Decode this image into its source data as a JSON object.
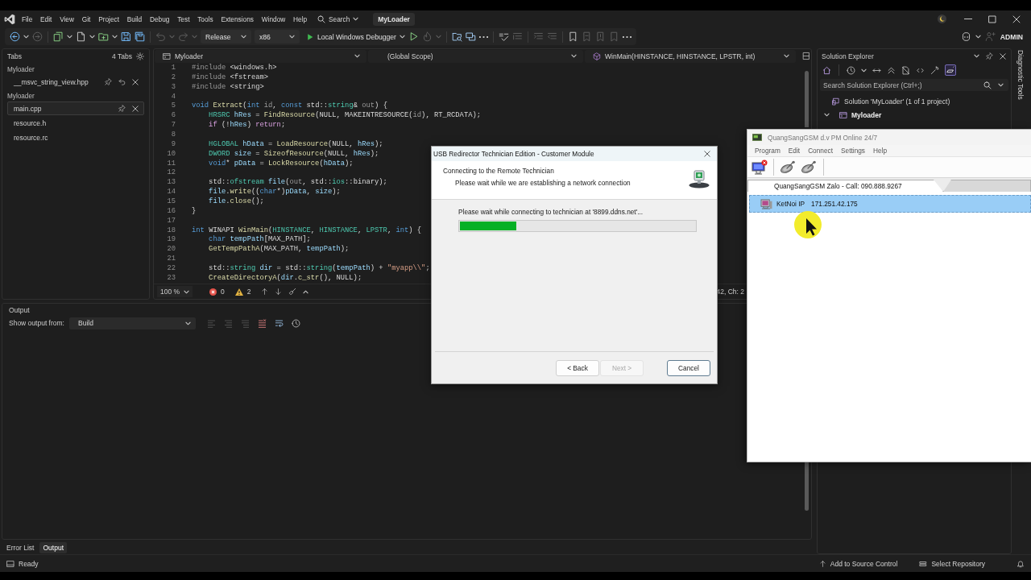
{
  "ide": {
    "menu": [
      "File",
      "Edit",
      "View",
      "Git",
      "Project",
      "Build",
      "Debug",
      "Test",
      "Tools",
      "Extensions",
      "Window",
      "Help"
    ],
    "search": "Search",
    "solution_title": "MyLoader",
    "configuration": "Release",
    "platform": "x86",
    "debugger": "Local Windows Debugger",
    "account": "ADMIN"
  },
  "tabs_panel": {
    "title": "Tabs",
    "count": "4 Tabs",
    "groups": [
      {
        "name": "Myloader",
        "files": [
          {
            "name": "__msvc_string_view.hpp",
            "kind": "preview",
            "selected": false
          }
        ]
      },
      {
        "name": "Myloader",
        "files": [
          {
            "name": "main.cpp",
            "kind": "document",
            "selected": true
          },
          {
            "name": "resource.h",
            "kind": "document",
            "selected": false
          },
          {
            "name": "resource.rc",
            "kind": "document",
            "selected": false
          }
        ]
      }
    ]
  },
  "editor": {
    "project": "Myloader",
    "scope": "(Global Scope)",
    "member": "WinMain(HINSTANCE, HINSTANCE, LPSTR, int)",
    "lines": [
      {
        "number": "1",
        "tokens": [
          {
            "kind": "pre",
            "text": "#include "
          },
          {
            "kind": "hdr",
            "text": "<windows.h>"
          }
        ]
      },
      {
        "number": "2",
        "tokens": [
          {
            "kind": "pre",
            "text": "#include "
          },
          {
            "kind": "hdr",
            "text": "<fstream>"
          }
        ]
      },
      {
        "number": "3",
        "tokens": [
          {
            "kind": "pre",
            "text": "#include "
          },
          {
            "kind": "hdr",
            "text": "<string>"
          }
        ]
      },
      {
        "number": "4"
      },
      {
        "number": "5",
        "tokens": [
          {
            "kind": "kw",
            "text": "void "
          },
          {
            "kind": "fn",
            "text": "Extract"
          },
          {
            "kind": "txt",
            "text": "("
          },
          {
            "kind": "kw",
            "text": "int "
          },
          {
            "kind": "param",
            "text": "id"
          },
          {
            "kind": "txt",
            "text": ", "
          },
          {
            "kind": "kw",
            "text": "const "
          },
          {
            "kind": "txt",
            "text": "std::"
          },
          {
            "kind": "type",
            "text": "string"
          },
          {
            "kind": "txt",
            "text": "& "
          },
          {
            "kind": "param",
            "text": "out"
          },
          {
            "kind": "txt",
            "text": ") {"
          }
        ]
      },
      {
        "number": "6",
        "tokens": [
          {
            "kind": "type",
            "text": "    HRSRC "
          },
          {
            "kind": "var",
            "text": "hRes"
          },
          {
            "kind": "txt",
            "text": " = "
          },
          {
            "kind": "fn",
            "text": "FindResource"
          },
          {
            "kind": "txt",
            "text": "(NULL, MAKEINTRESOURCE("
          },
          {
            "kind": "param",
            "text": "id"
          },
          {
            "kind": "txt",
            "text": "), RT_RCDATA);"
          }
        ]
      },
      {
        "number": "7",
        "tokens": [
          {
            "kind": "ctl",
            "text": "    if "
          },
          {
            "kind": "txt",
            "text": "(!"
          },
          {
            "kind": "var",
            "text": "hRes"
          },
          {
            "kind": "txt",
            "text": ") "
          },
          {
            "kind": "ctl",
            "text": "return"
          },
          {
            "kind": "txt",
            "text": ";"
          }
        ]
      },
      {
        "number": "8"
      },
      {
        "number": "9",
        "tokens": [
          {
            "kind": "type",
            "text": "    HGLOBAL "
          },
          {
            "kind": "var",
            "text": "hData"
          },
          {
            "kind": "txt",
            "text": " = "
          },
          {
            "kind": "fn",
            "text": "LoadResource"
          },
          {
            "kind": "txt",
            "text": "(NULL, "
          },
          {
            "kind": "var",
            "text": "hRes"
          },
          {
            "kind": "txt",
            "text": ");"
          }
        ]
      },
      {
        "number": "10",
        "tokens": [
          {
            "kind": "type",
            "text": "    DWORD "
          },
          {
            "kind": "var",
            "text": "size"
          },
          {
            "kind": "txt",
            "text": " = "
          },
          {
            "kind": "fn",
            "text": "SizeofResource"
          },
          {
            "kind": "txt",
            "text": "(NULL, "
          },
          {
            "kind": "var",
            "text": "hRes"
          },
          {
            "kind": "txt",
            "text": ");"
          }
        ]
      },
      {
        "number": "11",
        "tokens": [
          {
            "kind": "kw",
            "text": "    void"
          },
          {
            "kind": "txt",
            "text": "* "
          },
          {
            "kind": "var",
            "text": "pData"
          },
          {
            "kind": "txt",
            "text": " = "
          },
          {
            "kind": "fn",
            "text": "LockResource"
          },
          {
            "kind": "txt",
            "text": "("
          },
          {
            "kind": "var",
            "text": "hData"
          },
          {
            "kind": "txt",
            "text": ");"
          }
        ]
      },
      {
        "number": "12"
      },
      {
        "number": "13",
        "tokens": [
          {
            "kind": "txt",
            "text": "    std::"
          },
          {
            "kind": "type",
            "text": "ofstream "
          },
          {
            "kind": "var",
            "text": "file"
          },
          {
            "kind": "txt",
            "text": "("
          },
          {
            "kind": "param",
            "text": "out"
          },
          {
            "kind": "txt",
            "text": ", std::"
          },
          {
            "kind": "type",
            "text": "ios"
          },
          {
            "kind": "txt",
            "text": "::binary);"
          }
        ]
      },
      {
        "number": "14",
        "tokens": [
          {
            "kind": "var",
            "text": "    file"
          },
          {
            "kind": "txt",
            "text": "."
          },
          {
            "kind": "fn",
            "text": "write"
          },
          {
            "kind": "txt",
            "text": "(("
          },
          {
            "kind": "kw",
            "text": "char"
          },
          {
            "kind": "txt",
            "text": "*)"
          },
          {
            "kind": "var",
            "text": "pData"
          },
          {
            "kind": "txt",
            "text": ", "
          },
          {
            "kind": "var",
            "text": "size"
          },
          {
            "kind": "txt",
            "text": ");"
          }
        ]
      },
      {
        "number": "15",
        "tokens": [
          {
            "kind": "var",
            "text": "    file"
          },
          {
            "kind": "txt",
            "text": "."
          },
          {
            "kind": "fn",
            "text": "close"
          },
          {
            "kind": "txt",
            "text": "();"
          }
        ]
      },
      {
        "number": "16",
        "tokens": [
          {
            "kind": "txt",
            "text": "}"
          }
        ]
      },
      {
        "number": "17"
      },
      {
        "number": "18",
        "tokens": [
          {
            "kind": "kw",
            "text": "int "
          },
          {
            "kind": "txt",
            "text": "WINAPI "
          },
          {
            "kind": "fn",
            "text": "WinMain"
          },
          {
            "kind": "txt",
            "text": "("
          },
          {
            "kind": "type",
            "text": "HINSTANCE"
          },
          {
            "kind": "txt",
            "text": ", "
          },
          {
            "kind": "type",
            "text": "HINSTANCE"
          },
          {
            "kind": "txt",
            "text": ", "
          },
          {
            "kind": "type",
            "text": "LPSTR"
          },
          {
            "kind": "txt",
            "text": ", "
          },
          {
            "kind": "kw",
            "text": "int"
          },
          {
            "kind": "txt",
            "text": ") {"
          }
        ]
      },
      {
        "number": "19",
        "tokens": [
          {
            "kind": "kw",
            "text": "    char "
          },
          {
            "kind": "var",
            "text": "tempPath"
          },
          {
            "kind": "txt",
            "text": "[MAX_PATH];"
          }
        ]
      },
      {
        "number": "20",
        "tokens": [
          {
            "kind": "fn",
            "text": "    GetTempPathA"
          },
          {
            "kind": "txt",
            "text": "(MAX_PATH, "
          },
          {
            "kind": "var",
            "text": "tempPath"
          },
          {
            "kind": "txt",
            "text": ");"
          }
        ]
      },
      {
        "number": "21"
      },
      {
        "number": "22",
        "tokens": [
          {
            "kind": "txt",
            "text": "    std::"
          },
          {
            "kind": "type",
            "text": "string "
          },
          {
            "kind": "var",
            "text": "dir"
          },
          {
            "kind": "txt",
            "text": " = std::"
          },
          {
            "kind": "type",
            "text": "string"
          },
          {
            "kind": "txt",
            "text": "("
          },
          {
            "kind": "var",
            "text": "tempPath"
          },
          {
            "kind": "txt",
            "text": ") + "
          },
          {
            "kind": "str",
            "text": "\"myapp\\\\\""
          },
          {
            "kind": "txt",
            "text": ";"
          }
        ]
      },
      {
        "number": "23",
        "tokens": [
          {
            "kind": "fn",
            "text": "    CreateDirectoryA"
          },
          {
            "kind": "txt",
            "text": "("
          },
          {
            "kind": "var",
            "text": "dir"
          },
          {
            "kind": "txt",
            "text": "."
          },
          {
            "kind": "fn",
            "text": "c_str"
          },
          {
            "kind": "txt",
            "text": "(), NULL);"
          }
        ]
      }
    ],
    "zoom": "100 %",
    "errors": "0",
    "warnings": "2",
    "position": "42, Ch: 2"
  },
  "output": {
    "title": "Output",
    "source_label": "Show output from:",
    "source": "Build"
  },
  "bottom_tabs": [
    {
      "label": "Error List",
      "selected": false
    },
    {
      "label": "Output",
      "selected": true
    }
  ],
  "solution_explorer": {
    "title": "Solution Explorer",
    "search": {
      "placeholder": "Search Solution Explorer (Ctrl+;)"
    },
    "tree": [
      {
        "label": "Solution 'MyLoader' (1 of 1 project)",
        "kind": "solution",
        "children": [
          {
            "label": "Myloader",
            "kind": "project",
            "expanded": true
          }
        ]
      }
    ]
  },
  "side_strip": {
    "label": "Diagnostic Tools"
  },
  "status_bar": {
    "state": "Ready",
    "source_control": "Add to Source Control",
    "repository": "Select Repository"
  },
  "usb_dialog": {
    "title": "USB Redirector Technician Edition - Customer Module",
    "heading": "Connecting to the Remote Technician",
    "subheading": "Please wait while we are establishing a network connection",
    "message": "Please wait while connecting to technician at '8899.ddns.net'...",
    "progress": {
      "level": 0.24
    },
    "buttons": [
      {
        "label": "< Back",
        "disabled": false,
        "focused": false
      },
      {
        "label": "Next >",
        "disabled": true,
        "focused": false
      },
      {
        "label": "Cancel",
        "disabled": false,
        "focused": true
      }
    ]
  },
  "remote_window": {
    "title": "QuangSangGSM d.v PM Online 24/7",
    "menu": [
      "Program",
      "Edit",
      "Connect",
      "Settings",
      "Help"
    ],
    "tabs": [
      {
        "label": "QuangSangGSM Zalo - Call: 090.888.9267",
        "selected": true
      },
      {
        "selected": false
      }
    ],
    "connections": [
      {
        "name": "KetNoi IP",
        "address": "171.251.42.175",
        "selected": true
      }
    ]
  }
}
